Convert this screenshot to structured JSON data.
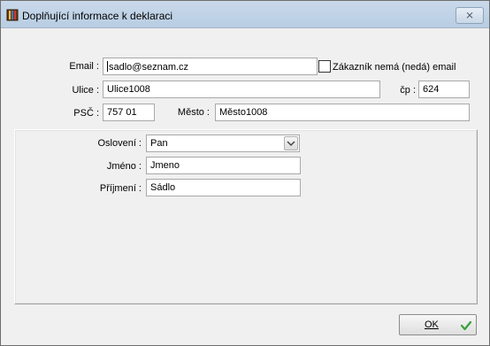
{
  "window": {
    "title": "Doplňující informace k deklaraci",
    "close_glyph": "⨯",
    "icon": "app-book-icon"
  },
  "contact": {
    "email_label": "Email :",
    "email_value": "sadlo@seznam.cz",
    "no_email_label": "Zákazník nemá (nedá) email",
    "no_email_checked": false,
    "street_label": "Ulice :",
    "street_value": "Ulice1008",
    "house_no_label": "čp :",
    "house_no_value": "624",
    "zip_label": "PSČ :",
    "zip_value": "757 01",
    "city_label": "Město :",
    "city_value": "Město1008"
  },
  "person": {
    "salutation_label": "Oslovení :",
    "salutation_value": "Pan",
    "first_name_label": "Jméno :",
    "first_name_value": "Jmeno",
    "last_name_label": "Příjmení :",
    "last_name_value": "Sádlo"
  },
  "footer": {
    "ok_label": "OK",
    "ok_icon": "checkmark-icon",
    "ok_icon_color": "#3aa03a"
  }
}
